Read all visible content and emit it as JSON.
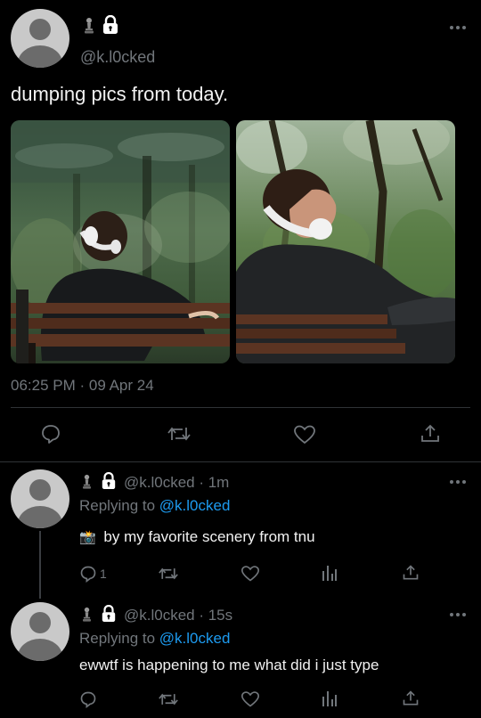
{
  "main_tweet": {
    "handle": "@k.l0cked",
    "text": "dumping pics from today.",
    "timestamp": "06:25 PM · 09 Apr 24",
    "photos": [
      {
        "subject": "person with headphones sitting on park bench facing pond"
      },
      {
        "subject": "person with headphones leaning back on bench looking at trees"
      }
    ],
    "actions": [
      "reply-icon",
      "retweet-icon",
      "like-icon",
      "share-icon"
    ]
  },
  "reply1": {
    "handle_time": "@k.l0cked · 1m",
    "replying_prefix": "Replying to ",
    "replying_handle": "@k.l0cked",
    "emoji": "📸",
    "text": "by my favorite scenery from tnu",
    "reply_count": "1"
  },
  "reply2": {
    "handle_time": "@k.l0cked · 15s",
    "replying_prefix": "Replying to ",
    "replying_handle": "@k.l0cked",
    "text": "ewwtf is happening to me what did i just type"
  },
  "colors": {
    "background": "#000000",
    "text": "#e7e9ea",
    "secondary": "#71767b",
    "link": "#1d9bf0",
    "divider": "#2f3336"
  }
}
